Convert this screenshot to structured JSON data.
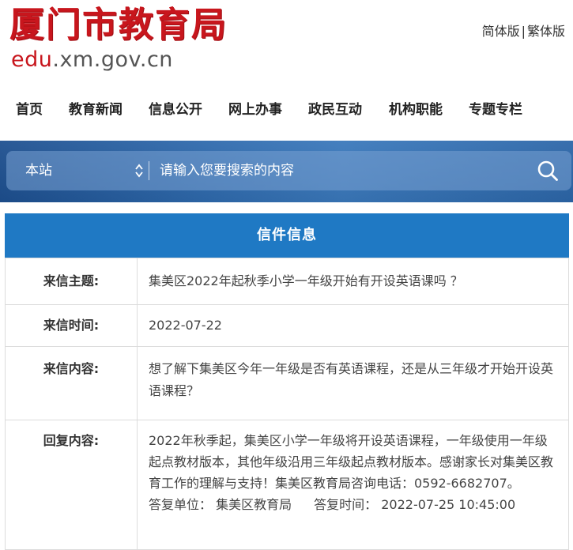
{
  "site": {
    "logo_cn": "厦门市教育局",
    "logo_en_red": "edu",
    "logo_en_rest": ".xm.gov.cn"
  },
  "lang": {
    "simplified": "简体版",
    "separator": "|",
    "traditional": "繁体版"
  },
  "nav": {
    "items": [
      "首页",
      "教育新闻",
      "信息公开",
      "网上办事",
      "政民互动",
      "机构职能",
      "专题专栏"
    ]
  },
  "search": {
    "scope": "本站",
    "placeholder": "请输入您要搜索的内容",
    "icon": "search-icon"
  },
  "letter": {
    "title": "信件信息",
    "rows": [
      {
        "label": "来信主题:",
        "value": "集美区2022年起秋季小学一年级开始有开设英语课吗 ？"
      },
      {
        "label": "来信时间:",
        "value": "2022-07-22"
      },
      {
        "label": "来信内容:",
        "value": "想了解下集美区今年一年级是否有英语课程，还是从三年级才开始开设英语课程？"
      },
      {
        "label": "回复内容:",
        "value": "2022年秋季起，集美区小学一年级将开设英语课程，一年级使用一年级起点教材版本，其他年级沿用三年级起点教材版本。感谢家长对集美区教育工作的理解与支持！集美区教育局咨询电话：0592-6682707。"
      }
    ],
    "reply_unit_label": "答复单位：",
    "reply_unit": "集美区教育局",
    "reply_time_label": "答复时间：",
    "reply_time": "2022-07-25 10:45:00"
  },
  "colors": {
    "brand_red": "#c8161d",
    "primary_blue": "#1f79c4"
  }
}
